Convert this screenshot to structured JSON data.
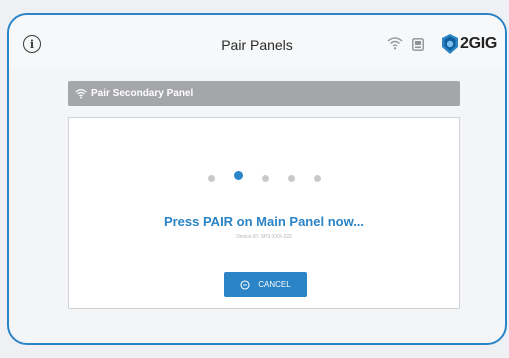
{
  "header": {
    "title": "Pair Panels",
    "info_icon": "info-circle-icon",
    "wifi_icon": "wifi-icon",
    "panel_icon": "panel-status-icon",
    "logo_text": "2GIG"
  },
  "section": {
    "icon": "wifi-icon",
    "label": "Pair Secondary Panel"
  },
  "pairing": {
    "progress_step": 2,
    "progress_total": 5,
    "prompt": "Press PAIR on Main Panel now...",
    "device_id": "Device ID: SP3-XXX-222",
    "cancel_label": "CANCEL",
    "cancel_icon": "cancel-circle-icon"
  },
  "colors": {
    "accent": "#2b84c6",
    "section_bar": "#a4a6a9",
    "bezel": "#2b84c6"
  }
}
